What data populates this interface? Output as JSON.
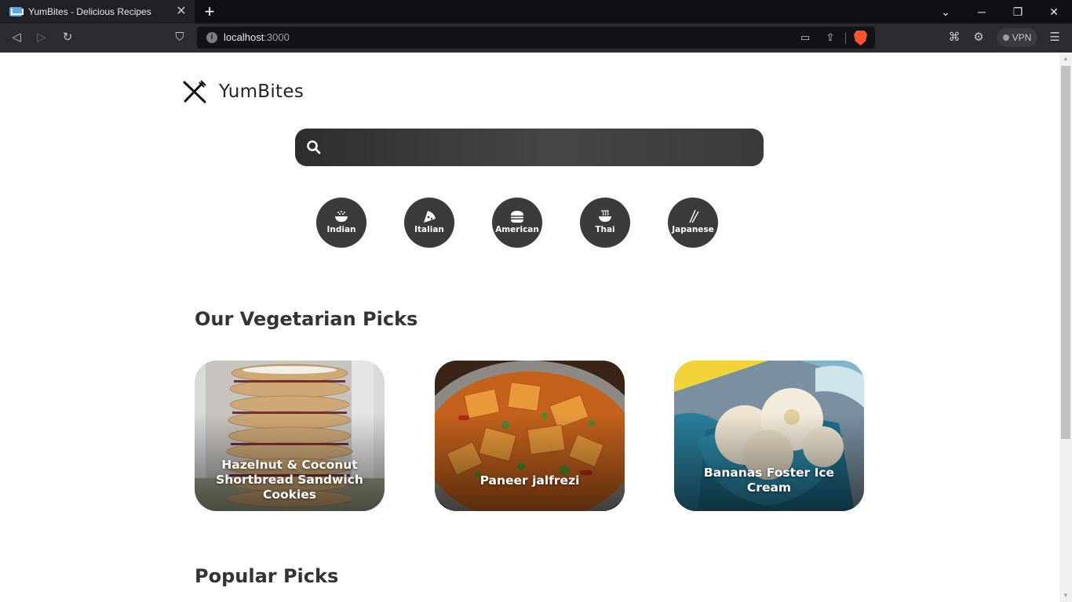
{
  "browser": {
    "tab_title": "YumBites - Delicious Recipes",
    "url_host": "localhost",
    "url_port": ":3000",
    "vpn_label": "VPN",
    "brand_color": "#fb542b"
  },
  "app": {
    "name": "YumBites",
    "search_placeholder": ""
  },
  "cuisines": [
    {
      "label": "Indian",
      "icon": "bowl-rice-icon"
    },
    {
      "label": "Italian",
      "icon": "pizza-icon"
    },
    {
      "label": "American",
      "icon": "burger-icon"
    },
    {
      "label": "Thai",
      "icon": "noodle-bowl-icon"
    },
    {
      "label": "Japanese",
      "icon": "chopsticks-icon"
    }
  ],
  "sections": {
    "vegetarian_title": "Our Vegetarian Picks",
    "popular_title": "Popular Picks"
  },
  "vegetarian_picks": [
    {
      "title": "Hazelnut & Coconut Shortbread Sandwich Cookies"
    },
    {
      "title": "Paneer jalfrezi"
    },
    {
      "title": "Bananas Foster Ice Cream"
    }
  ],
  "colors": {
    "cuisine_bg": "#3b3b3b",
    "search_bg": "#3a3a3a",
    "heading": "#333333"
  }
}
